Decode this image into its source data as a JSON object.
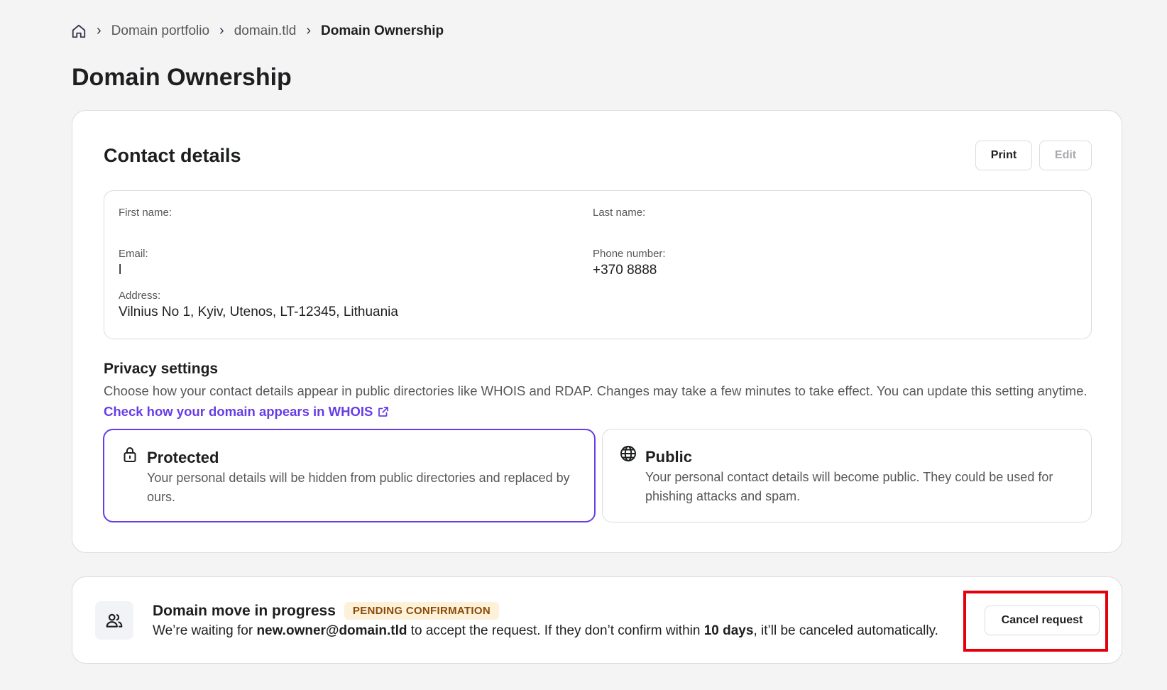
{
  "breadcrumb": {
    "home_icon": "home-icon",
    "items": [
      "Domain portfolio",
      "domain.tld"
    ],
    "current": "Domain Ownership"
  },
  "page": {
    "title": "Domain Ownership"
  },
  "contact": {
    "title": "Contact details",
    "print_label": "Print",
    "edit_label": "Edit",
    "fields": {
      "first_name": {
        "label": "First name:",
        "value": ""
      },
      "last_name": {
        "label": "Last name:",
        "value": ""
      },
      "email": {
        "label": "Email:",
        "value": "l"
      },
      "phone": {
        "label": "Phone number:",
        "value": "+370 8888"
      },
      "address": {
        "label": "Address:",
        "value": "Vilnius No 1, Kyiv, Utenos, LT-12345, Lithuania"
      }
    }
  },
  "privacy": {
    "title": "Privacy settings",
    "description": "Choose how your contact details appear in public directories like WHOIS and RDAP. Changes may take a few minutes to take effect. You can update this setting anytime.",
    "link_label": "Check how your domain appears in WHOIS",
    "options": {
      "protected": {
        "title": "Protected",
        "description": "Your personal details will be hidden from public directories and replaced by ours.",
        "icon": "lock-icon",
        "selected": true
      },
      "public": {
        "title": "Public",
        "description": "Your personal contact details will become public. They could be used for phishing attacks and spam.",
        "icon": "globe-icon",
        "selected": false
      }
    }
  },
  "move": {
    "icon": "users-icon",
    "title": "Domain move in progress",
    "badge": "PENDING CONFIRMATION",
    "desc_prefix": "We’re waiting for ",
    "email": "new.owner@domain.tld",
    "desc_middle": " to accept the request. If they don’t confirm within ",
    "days": "10 days",
    "desc_suffix": ", it’ll be canceled automatically.",
    "cancel_label": "Cancel request"
  },
  "colors": {
    "accent": "#673de6",
    "highlight": "#e3000b",
    "badge_bg": "#fdf1d9",
    "badge_text": "#8a4a07"
  }
}
